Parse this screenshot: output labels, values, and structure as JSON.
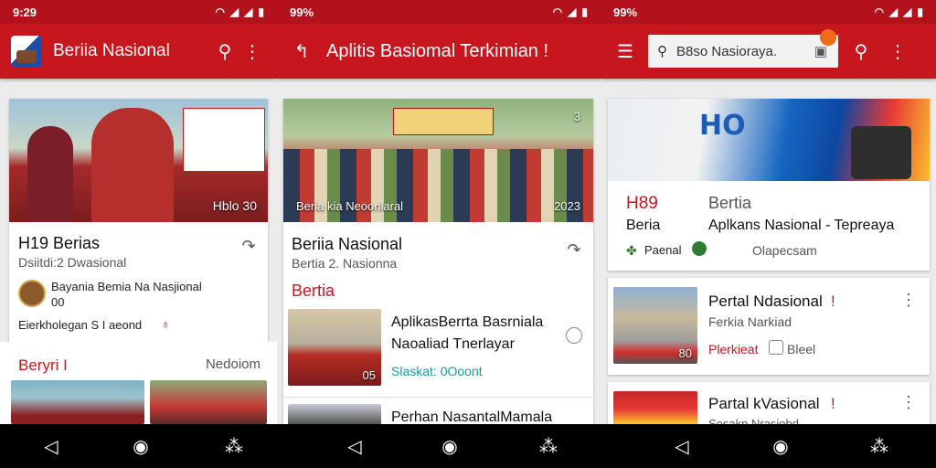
{
  "colors": {
    "brand": "#c8161e",
    "statusbar": "#b3121b",
    "accent_teal": "#14a0a0"
  },
  "screen1": {
    "time": "9:29",
    "title": "Beriia Nasional",
    "hero_overlay": "Hblo 30",
    "card_title": "H19 Berias",
    "card_sub": "Dsiitdi:2 Dwasional",
    "source_line1": "Bayania Bemia Na Nasjional",
    "source_line2": "00",
    "footer": "Eierkholegan S I aeond",
    "section_left": "Beryri I",
    "section_right": "Nedoiom"
  },
  "screen2": {
    "time": "99%",
    "title": "Aplitis Basiomal Terkimian !",
    "hero_overlay_left": "Beria kia Neoonlaral",
    "hero_overlay_right": "2023",
    "hero_corner": "3",
    "card_title": "Beriia Nasional",
    "card_sub": "Bertia 2. Nasionna",
    "section": "Bertia",
    "item1_title_l1": "AplikasBerrta Basrniala",
    "item1_title_l2": "Naoaliad Tnerlayar",
    "item1_meta": "Slaskat: 0Ooont",
    "item1_badge": "05",
    "item2_title": "Perhan NasantalMamala"
  },
  "screen3": {
    "time": "99%",
    "search_placeholder": "B8so Nasioraya.",
    "banner_text": "HO",
    "card_left_title": "H89",
    "card_left_sub": "Beria",
    "card_right_title": "Bertia",
    "card_right_sub": "Aplkans Nasional - Tepreaya",
    "card_meta_left": "Paenal",
    "card_meta_right": "Olapecsam",
    "item1_title": "Pertal Ndasional",
    "item1_sub": "Ferkia Narkiad",
    "item1_meta_red": "Plerkieat",
    "item1_meta_grey": "Bleel",
    "item1_badge": "80",
    "item2_title": "Partal kVasional",
    "item2_sub": "Sosakn Nrasiobd"
  },
  "icons": [
    "wifi-icon",
    "signal-icon",
    "battery-icon",
    "search-icon",
    "more-icon",
    "back-icon",
    "menu-icon",
    "share-icon",
    "nav-back-icon",
    "nav-home-icon",
    "nav-recent-icon"
  ]
}
